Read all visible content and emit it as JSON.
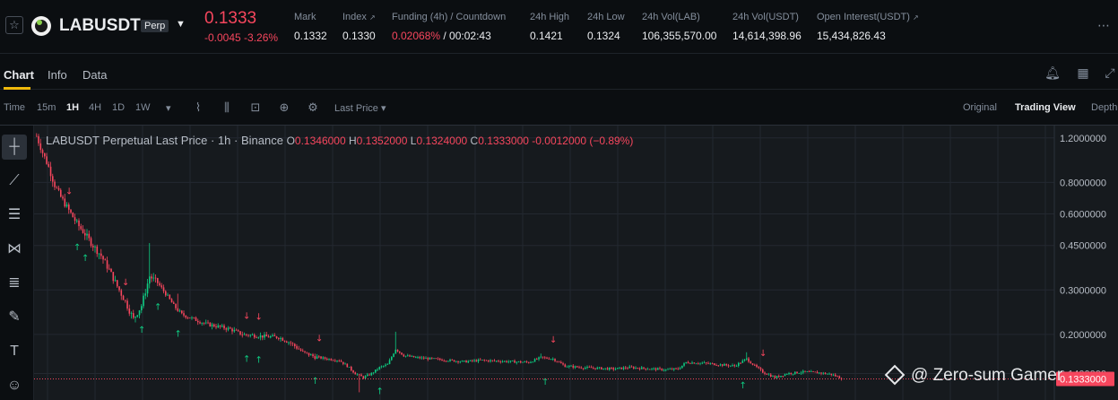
{
  "header": {
    "symbol": "LABUSDT",
    "badge": "Perp",
    "price": "0.1333",
    "change": "-0.0045 -3.26%",
    "stats": {
      "mark": {
        "label": "Mark",
        "value": "0.1332"
      },
      "index": {
        "label": "Index",
        "value": "0.1330"
      },
      "funding": {
        "label": "Funding (4h) / Countdown",
        "rate": "0.02068%",
        "countdown": " / 00:02:43"
      },
      "high": {
        "label": "24h High",
        "value": "0.1421"
      },
      "low": {
        "label": "24h Low",
        "value": "0.1324"
      },
      "vol_lab": {
        "label": "24h Vol(LAB)",
        "value": "106,355,570.00"
      },
      "vol_usdt": {
        "label": "24h Vol(USDT)",
        "value": "14,614,398.96"
      },
      "oi": {
        "label": "Open Interest(USDT)",
        "value": "15,434,826.43"
      }
    },
    "more_icon": "more-icon"
  },
  "tabs": {
    "chart": "Chart",
    "info": "Info",
    "data": "Data"
  },
  "toolbar": {
    "time": "Time",
    "intervals": [
      "15m",
      "1H",
      "4H",
      "1D",
      "1W"
    ],
    "active_interval": "1H",
    "price_type": "Last Price",
    "views": {
      "original": "Original",
      "tradingview": "Trading View",
      "depth": "Depth"
    }
  },
  "legend": {
    "title": "LABUSDT Perpetual Last Price · 1h · Binance",
    "o": "0.1346000",
    "h": "0.1352000",
    "l": "0.1324000",
    "c": "0.1333000",
    "chg": "-0.0012000 (−0.89%)"
  },
  "watermark": "@ Zero-sum Gamer",
  "colors": {
    "up": "#0ecb81",
    "down": "#f6465d",
    "accent": "#f0b90b",
    "bg": "#161a1e"
  },
  "chart_data": {
    "type": "candlestick",
    "scale": "log",
    "ylim": [
      0.11,
      1.3
    ],
    "y_ticks": [
      "1.2000000",
      "0.8000000",
      "0.6000000",
      "0.4500000",
      "0.3000000",
      "0.2000000",
      "0.1400000"
    ],
    "last_price_label": "0.1333000",
    "last_price": 0.1333,
    "trend": [
      [
        0,
        1.22
      ],
      [
        3,
        1.05
      ],
      [
        6,
        0.92
      ],
      [
        9,
        0.78
      ],
      [
        12,
        0.7
      ],
      [
        16,
        0.62
      ],
      [
        20,
        0.55
      ],
      [
        24,
        0.5
      ],
      [
        28,
        0.45
      ],
      [
        32,
        0.41
      ],
      [
        36,
        0.36
      ],
      [
        40,
        0.31
      ],
      [
        44,
        0.27
      ],
      [
        48,
        0.23
      ],
      [
        52,
        0.26
      ],
      [
        56,
        0.34
      ],
      [
        60,
        0.32
      ],
      [
        64,
        0.29
      ],
      [
        68,
        0.26
      ],
      [
        72,
        0.24
      ],
      [
        78,
        0.23
      ],
      [
        84,
        0.22
      ],
      [
        90,
        0.215
      ],
      [
        96,
        0.21
      ],
      [
        102,
        0.2
      ],
      [
        108,
        0.198
      ],
      [
        114,
        0.196
      ],
      [
        120,
        0.195
      ],
      [
        126,
        0.185
      ],
      [
        132,
        0.17
      ],
      [
        138,
        0.163
      ],
      [
        144,
        0.16
      ],
      [
        150,
        0.158
      ],
      [
        154,
        0.15
      ],
      [
        158,
        0.14
      ],
      [
        162,
        0.135
      ],
      [
        166,
        0.14
      ],
      [
        170,
        0.148
      ],
      [
        174,
        0.152
      ],
      [
        178,
        0.175
      ],
      [
        182,
        0.165
      ],
      [
        188,
        0.162
      ],
      [
        196,
        0.16
      ],
      [
        204,
        0.158
      ],
      [
        212,
        0.156
      ],
      [
        220,
        0.158
      ],
      [
        228,
        0.157
      ],
      [
        236,
        0.156
      ],
      [
        244,
        0.155
      ],
      [
        250,
        0.162
      ],
      [
        256,
        0.16
      ],
      [
        262,
        0.15
      ],
      [
        270,
        0.148
      ],
      [
        278,
        0.147
      ],
      [
        286,
        0.146
      ],
      [
        294,
        0.148
      ],
      [
        300,
        0.147
      ],
      [
        306,
        0.146
      ],
      [
        312,
        0.145
      ],
      [
        318,
        0.146
      ],
      [
        322,
        0.155
      ],
      [
        330,
        0.154
      ],
      [
        338,
        0.152
      ],
      [
        346,
        0.15
      ],
      [
        352,
        0.16
      ],
      [
        356,
        0.15
      ],
      [
        360,
        0.142
      ],
      [
        366,
        0.135
      ],
      [
        372,
        0.14
      ],
      [
        380,
        0.142
      ],
      [
        388,
        0.141
      ],
      [
        394,
        0.139
      ],
      [
        400,
        0.1333
      ]
    ],
    "spikes": [
      [
        56,
        0.46
      ],
      [
        70,
        0.29
      ],
      [
        178,
        0.205
      ],
      [
        250,
        0.168
      ],
      [
        352,
        0.17
      ],
      [
        160,
        0.118
      ]
    ],
    "signals": {
      "up": [
        20,
        24,
        52,
        60,
        70,
        104,
        110,
        138,
        170,
        252,
        350
      ],
      "down": [
        16,
        44,
        104,
        110,
        140,
        256,
        360
      ]
    }
  }
}
